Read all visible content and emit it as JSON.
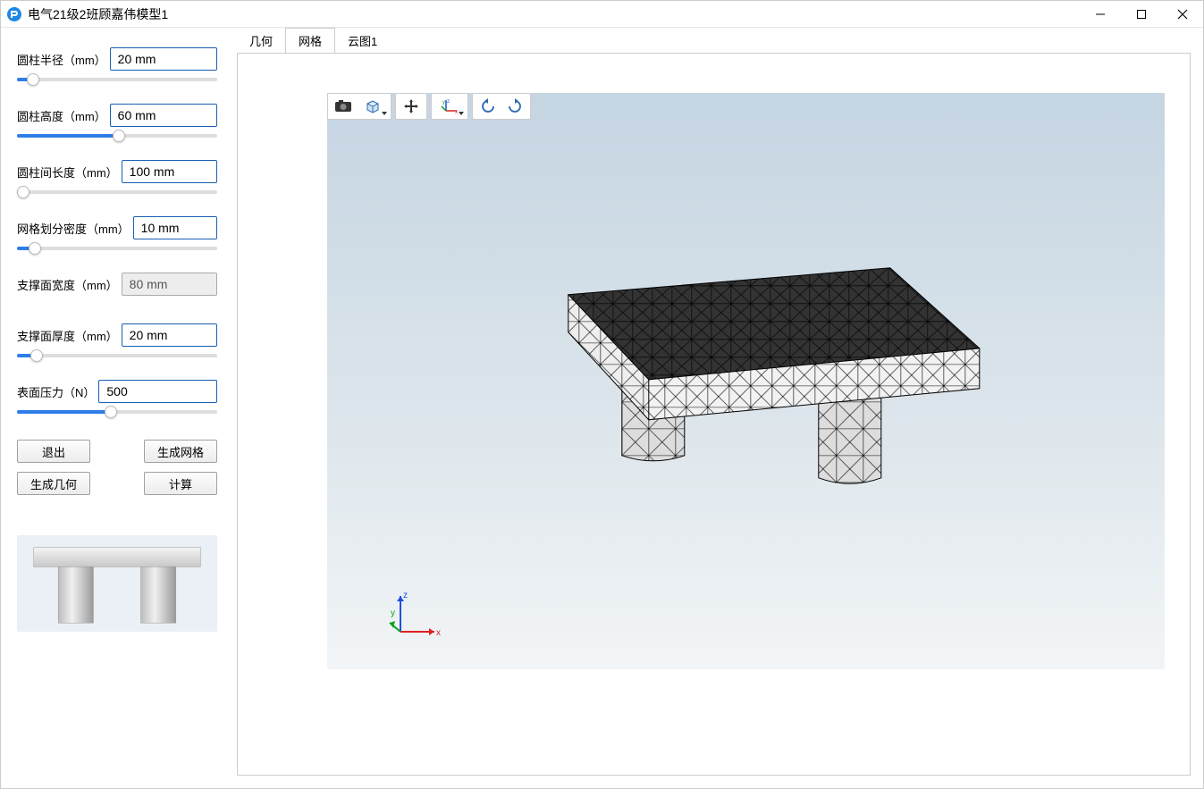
{
  "window": {
    "title": "电气21级2班顾嘉伟模型1"
  },
  "params": [
    {
      "label": "圆柱半径（mm）",
      "value": "20 mm",
      "slider_percent": 8,
      "readonly": false
    },
    {
      "label": "圆柱高度（mm）",
      "value": "60 mm",
      "slider_percent": 51,
      "readonly": false
    },
    {
      "label": "圆柱间长度（mm）",
      "value": "100 mm",
      "slider_percent": 3,
      "readonly": false
    },
    {
      "label": "网格划分密度（mm）",
      "value": "10 mm",
      "slider_percent": 9,
      "readonly": false
    },
    {
      "label": "支撑面宽度（mm）",
      "value": "80 mm",
      "slider_percent": null,
      "readonly": true
    },
    {
      "label": "支撑面厚度（mm）",
      "value": "20 mm",
      "slider_percent": 10,
      "readonly": false
    },
    {
      "label": "表面压力（N）",
      "value": "500",
      "slider_percent": 47,
      "readonly": false
    }
  ],
  "buttons": {
    "exit": "退出",
    "gen_mesh": "生成网格",
    "gen_geom": "生成几何",
    "compute": "计算"
  },
  "tabs": [
    {
      "id": "geometry",
      "label": "几何",
      "active": false
    },
    {
      "id": "mesh",
      "label": "网格",
      "active": true
    },
    {
      "id": "cloud",
      "label": "云图1",
      "active": false
    }
  ],
  "toolbar": {
    "icons": [
      "camera-icon",
      "cube-view-icon",
      "pan-icon",
      "axis-xyz-icon",
      "rotate-ccw-icon",
      "rotate-cw-icon"
    ]
  },
  "axis": {
    "x": "x",
    "y": "y",
    "z": "z"
  }
}
